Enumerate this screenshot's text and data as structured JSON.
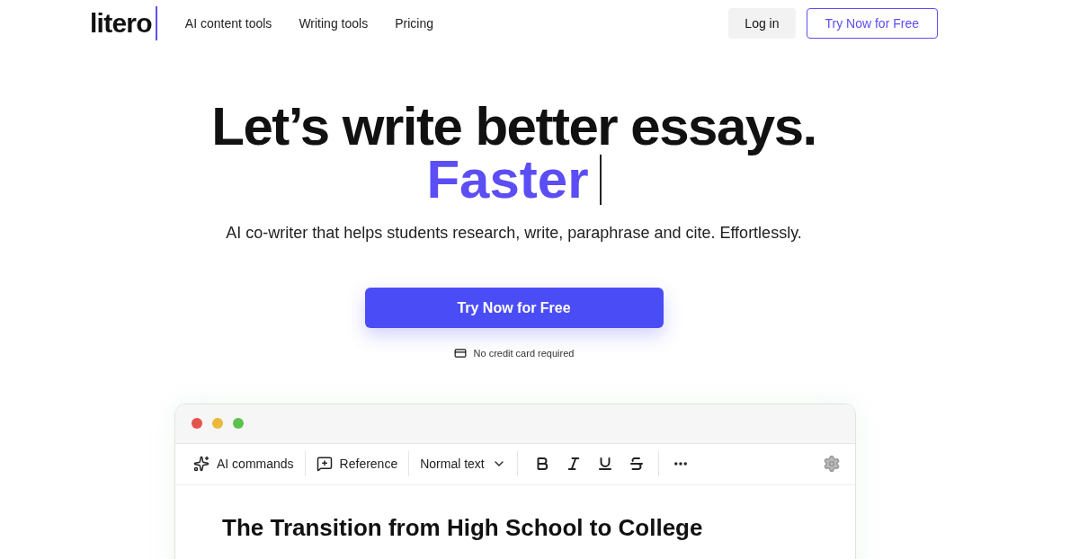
{
  "nav": {
    "logo": "litero",
    "links": [
      "AI content tools",
      "Writing tools",
      "Pricing"
    ],
    "login": "Log in",
    "cta": "Try Now for Free"
  },
  "hero": {
    "headline": "Let’s write better essays.",
    "highlight": "Faster",
    "subtitle": "AI co-writer that helps students research, write, paraphrase and cite. Effortlessly.",
    "cta": "Try Now for Free",
    "note": "No credit card required"
  },
  "editor": {
    "window_dots": [
      {
        "color": "#e5534b"
      },
      {
        "color": "#eab93a"
      },
      {
        "color": "#5cc14e"
      }
    ],
    "toolbar": [
      {
        "kind": "ai",
        "label": "AI commands"
      },
      {
        "kind": "reference",
        "label": "Reference"
      },
      {
        "kind": "style",
        "label": "Normal text"
      }
    ],
    "format_buttons": [
      {
        "kind": "bold"
      },
      {
        "kind": "italic"
      },
      {
        "kind": "underline"
      },
      {
        "kind": "strike"
      },
      {
        "kind": "more"
      }
    ],
    "document_title": "The Transition from High School to College"
  }
}
